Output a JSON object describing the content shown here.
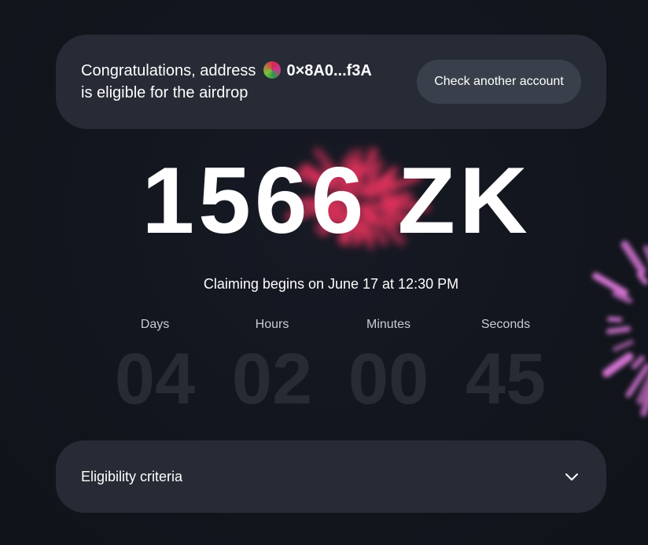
{
  "banner": {
    "line1_prefix": "Congratulations, address",
    "address": "0×8A0...f3A",
    "line2": "is eligible for the airdrop",
    "check_button": "Check another account"
  },
  "airdrop": {
    "amount": "1566 ZK",
    "claim_text": "Claiming begins on June 17 at 12:30 PM"
  },
  "countdown": {
    "labels": [
      "Days",
      "Hours",
      "Minutes",
      "Seconds"
    ],
    "values": [
      "04",
      "02",
      "00",
      "45"
    ]
  },
  "criteria": {
    "label": "Eligibility criteria",
    "icon": "chevron-down-icon"
  },
  "colors": {
    "background": "#13161f",
    "card": "#262b35",
    "button": "#3a404b",
    "countdown_digits": "#272b34",
    "firework_red": "#e8335e",
    "firework_pink": "#e37be0"
  }
}
